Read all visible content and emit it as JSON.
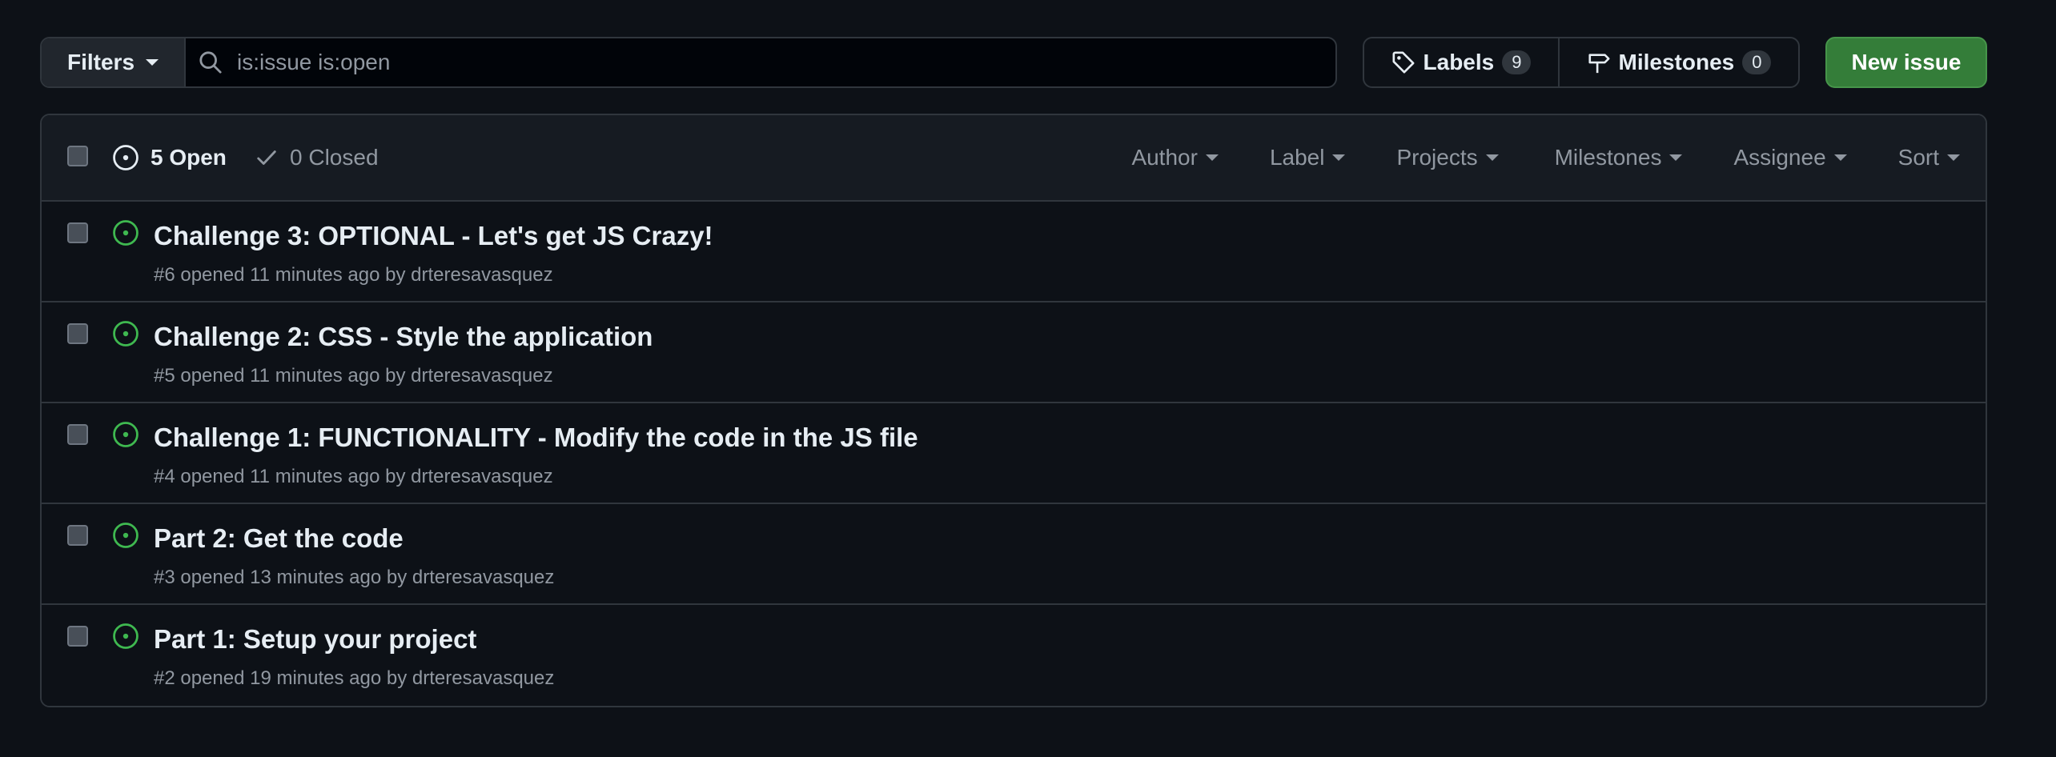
{
  "toolbar": {
    "filters_label": "Filters",
    "search_value": "is:issue is:open",
    "labels_label": "Labels",
    "labels_count": "9",
    "milestones_label": "Milestones",
    "milestones_count": "0",
    "new_issue_label": "New issue"
  },
  "header": {
    "open_label": "5 Open",
    "closed_label": "0 Closed",
    "filters": [
      "Author",
      "Label",
      "Projects",
      "Milestones",
      "Assignee",
      "Sort"
    ]
  },
  "issues": [
    {
      "title": "Challenge 3: OPTIONAL - Let's get JS Crazy!",
      "meta_prefix": "#6 opened 11 minutes ago by",
      "author": "drteresavasquez"
    },
    {
      "title": "Challenge 2: CSS - Style the application",
      "meta_prefix": "#5 opened 11 minutes ago by",
      "author": "drteresavasquez"
    },
    {
      "title": "Challenge 1: FUNCTIONALITY - Modify the code in the JS file",
      "meta_prefix": "#4 opened 11 minutes ago by",
      "author": "drteresavasquez"
    },
    {
      "title": "Part 2: Get the code",
      "meta_prefix": "#3 opened 13 minutes ago by",
      "author": "drteresavasquez"
    },
    {
      "title": "Part 1: Setup your project",
      "meta_prefix": "#2 opened 19 minutes ago by",
      "author": "drteresavasquez"
    }
  ],
  "colors": {
    "background": "#0d1117",
    "header_bg": "#161b22",
    "border": "#30363d",
    "open_icon": "#3fb950",
    "primary_button": "#347d39",
    "muted_text": "#9198a1"
  },
  "icons": {
    "filters_caret": "chevron-down-icon",
    "search": "search-icon",
    "labels": "tag-icon",
    "milestones": "milestone-icon",
    "open_state": "issue-opened-icon",
    "closed_state": "check-icon"
  }
}
